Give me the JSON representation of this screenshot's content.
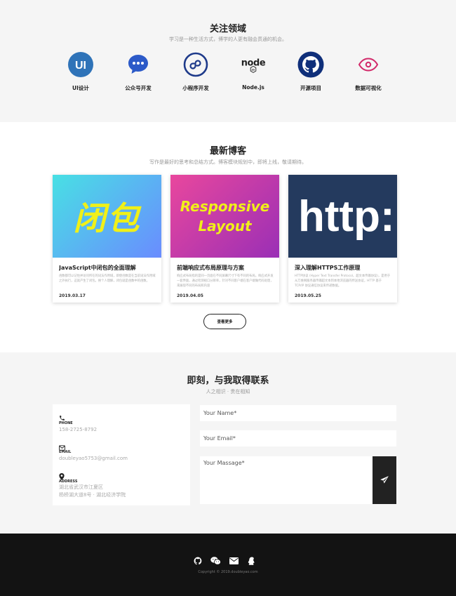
{
  "focus": {
    "title": "关注领域",
    "subtitle": "学习是一种生活方式，博学的人更有融会贯通的机会。",
    "items": [
      {
        "label": "UI设计",
        "icon": "ui-design-icon"
      },
      {
        "label": "公众号开发",
        "icon": "chat-bubble-icon"
      },
      {
        "label": "小程序开发",
        "icon": "mini-program-icon"
      },
      {
        "label": "Node.js",
        "icon": "nodejs-logo-icon"
      },
      {
        "label": "开源项目",
        "icon": "github-icon"
      },
      {
        "label": "数据可视化",
        "icon": "eye-icon"
      }
    ],
    "ui_icon_text": "UI",
    "node_logo_text": "node",
    "node_logo_badge": "JS"
  },
  "blog": {
    "title": "最新博客",
    "subtitle": "写作是最好的思考和总结方式。博客模块规划中，即将上线，敬请期待。",
    "posts": [
      {
        "image_text": "闭包",
        "title": "JavaScript中闭包的全面理解",
        "excerpt": "函数都可以记住并访问所在的词法作用域，即使函数是在当前词法作用域之外执行，这就产生了闭包。换个人理解，闭包就是函数中的函数。",
        "date": "2019.03.17"
      },
      {
        "image_text_line1": "Responsive",
        "image_text_line2": "Layout",
        "title": "前端响应式布局原理与方案",
        "excerpt": "响应式布局指的是同一页面在不同屏幕尺寸下有不同的布局。响应式开发一套界面，通过检测视口分辨率，针对不同客户端在客户端做代码处理，来展现不同的布局和内容",
        "date": "2019.04.05"
      },
      {
        "image_text": "http:",
        "title": "深入理解HTTPS工作原理",
        "excerpt": "HTTP协议 (Hyper Text Transfer Protocol，超文本传输协议)，是用于从万维网服务器传输超文本到本地浏览器的传送协议，HTTP 基于 TCP/IP 协议通信协议来传递数据。",
        "date": "2019.05.25"
      }
    ],
    "more_label": "查看更多"
  },
  "contact": {
    "title": "即刻，与我取得联系",
    "subtitle": "人之相识 · 贵在相知",
    "phone_label": "PHONE",
    "phone_value": "158-2725-8792",
    "email_label": "EMAIL",
    "email_value": "doubleyao5753@gmail.com",
    "address_label": "ADDRESS",
    "address_line1": "湖北省武汉市江夏区",
    "address_line2": "杨桥湖大道8号 · 湖北经济学院",
    "name_placeholder": "Your Name*",
    "email_placeholder": "Your Email*",
    "message_placeholder": "Your Massage*"
  },
  "footer": {
    "social_icons": [
      "github-icon",
      "wechat-icon",
      "mail-icon",
      "qq-icon"
    ],
    "copyright": "Copyright © 2019.doubleyao.com"
  },
  "colors": {
    "ui_blue": "#2f73b8",
    "wechat_blue": "#2c5ac8",
    "program_navy": "#1e3a8a",
    "github_navy": "#0f2f7a",
    "eye_pink": "#d22a6a",
    "footer_bg": "#131313"
  }
}
